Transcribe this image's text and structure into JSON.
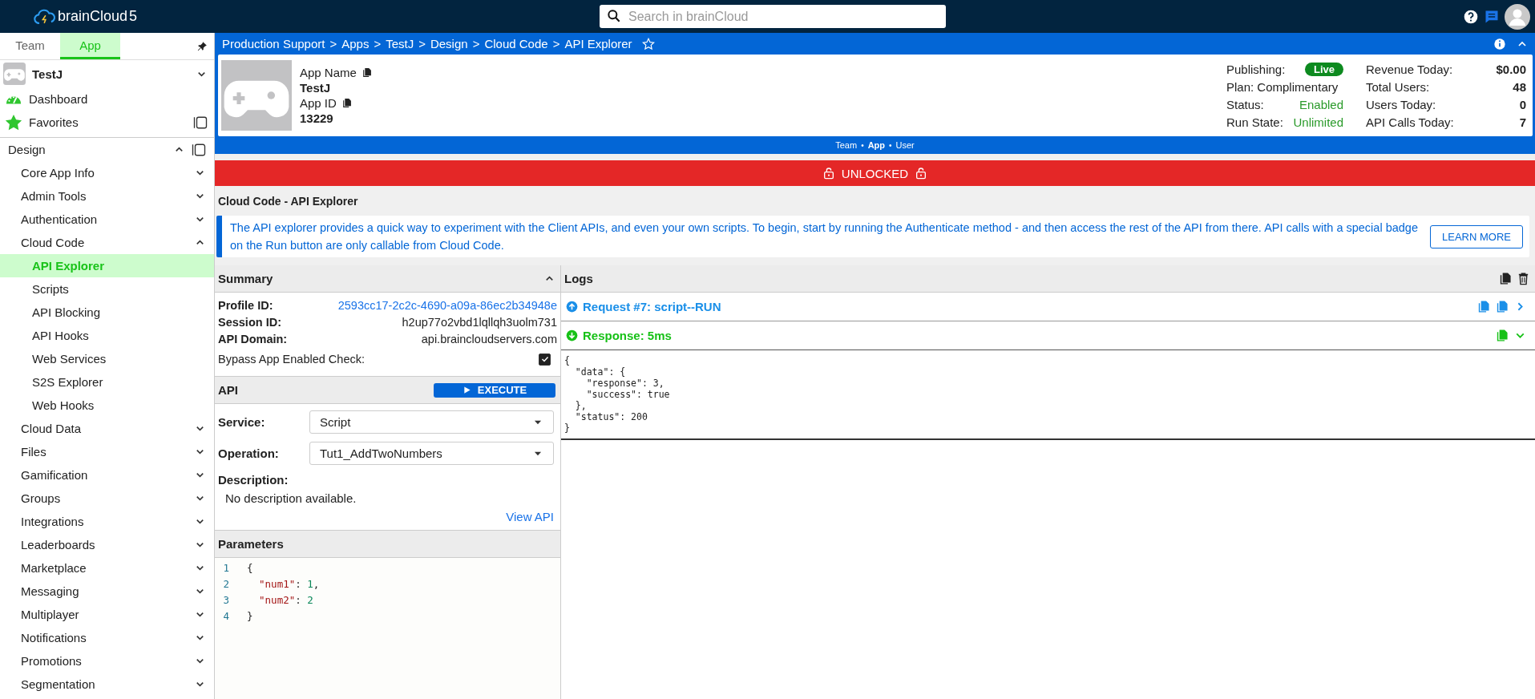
{
  "topbar": {
    "logo": "brainCloud",
    "logo_version": "5",
    "search": {
      "placeholder": "Search in brainCloud"
    }
  },
  "sidebar": {
    "tabs": [
      {
        "label": "Team",
        "selected": false
      },
      {
        "label": "App",
        "selected": true
      }
    ],
    "app": {
      "name": "TestJ"
    },
    "links": [
      {
        "label": "Dashboard",
        "kind": "dashboard"
      },
      {
        "label": "Favorites",
        "kind": "favorites"
      }
    ],
    "nav": [
      {
        "label": "Design",
        "expanded": true,
        "selected": false,
        "children": [
          {
            "label": "Core App Info",
            "expanded": false,
            "selected": false
          },
          {
            "label": "Admin Tools",
            "expanded": false,
            "selected": false
          },
          {
            "label": "Authentication",
            "expanded": false,
            "selected": false
          },
          {
            "label": "Cloud Code",
            "expanded": true,
            "selected": false,
            "children": [
              {
                "label": "API Explorer",
                "selected": true
              },
              {
                "label": "Scripts",
                "selected": false
              },
              {
                "label": "API Blocking",
                "selected": false
              },
              {
                "label": "API Hooks",
                "selected": false
              },
              {
                "label": "Web Services",
                "selected": false
              },
              {
                "label": "S2S Explorer",
                "selected": false
              },
              {
                "label": "Web Hooks",
                "selected": false
              }
            ]
          },
          {
            "label": "Cloud Data",
            "expanded": false,
            "selected": false
          },
          {
            "label": "Files",
            "expanded": false,
            "selected": false
          },
          {
            "label": "Gamification",
            "expanded": false,
            "selected": false
          },
          {
            "label": "Groups",
            "expanded": false,
            "selected": false
          },
          {
            "label": "Integrations",
            "expanded": false,
            "selected": false
          },
          {
            "label": "Leaderboards",
            "expanded": false,
            "selected": false
          },
          {
            "label": "Marketplace",
            "expanded": false,
            "selected": false
          },
          {
            "label": "Messaging",
            "expanded": false,
            "selected": false
          },
          {
            "label": "Multiplayer",
            "expanded": false,
            "selected": false
          },
          {
            "label": "Notifications",
            "expanded": false,
            "selected": false
          },
          {
            "label": "Promotions",
            "expanded": false,
            "selected": false
          },
          {
            "label": "Segmentation",
            "expanded": false,
            "selected": false
          }
        ]
      }
    ]
  },
  "breadcrumb_separator": ">",
  "context_separator": "•",
  "breadcrumb": [
    "Production Support",
    "Apps",
    "TestJ",
    "Design",
    "Cloud Code",
    "API Explorer"
  ],
  "app_info": {
    "name_label": "App Name",
    "name": "TestJ",
    "id_label": "App ID",
    "id": "13229",
    "publishing_label": "Publishing:",
    "publishing": "Live",
    "plan": "Plan: Complimentary",
    "status_label": "Status:",
    "status": "Enabled",
    "run_state_label": "Run State:",
    "run_state": "Unlimited",
    "stats": [
      {
        "label": "Revenue Today:",
        "value": "$0.00"
      },
      {
        "label": "Total Users:",
        "value": "48"
      },
      {
        "label": "Users Today:",
        "value": "0"
      },
      {
        "label": "API Calls Today:",
        "value": "7"
      }
    ]
  },
  "context": [
    {
      "label": "Team",
      "selected": false
    },
    {
      "label": "App",
      "selected": true
    },
    {
      "label": "User",
      "selected": false
    }
  ],
  "lock_banner": {
    "label": "UNLOCKED",
    "locked": false
  },
  "page_title": "Cloud Code - API Explorer",
  "info": {
    "text": "The API explorer provides a quick way to experiment with the Client APIs, and even your own scripts. To begin, start by running the Authenticate method - and then access the rest of the API from there. API calls with a special badge on the Run button are only callable from Cloud Code.",
    "button": "LEARN MORE"
  },
  "summary": {
    "title": "Summary",
    "expanded": true,
    "rows": [
      {
        "label": "Profile ID:",
        "value": "2593cc17-2c2c-4690-a09a-86ec2b34948e",
        "kind": "link"
      },
      {
        "label": "Session ID:",
        "value": "h2up77o2vbd1lqllqh3uolm731",
        "kind": "text"
      },
      {
        "label": "API Domain:",
        "value": "api.braincloudservers.com",
        "kind": "text"
      }
    ],
    "bypass": {
      "label": "Bypass App Enabled Check:",
      "checked": true
    }
  },
  "api": {
    "title": "API",
    "execute": "EXECUTE",
    "service_label": "Service:",
    "service": "Script",
    "operation_label": "Operation:",
    "operation": "Tut1_AddTwoNumbers",
    "description_label": "Description:",
    "description": "No description available.",
    "view_api": "View API"
  },
  "parameters": {
    "title": "Parameters",
    "lines": [
      {
        "number": "1",
        "text": "{"
      },
      {
        "number": "2",
        "text": "  \"num1\": 1,"
      },
      {
        "number": "3",
        "text": "  \"num2\": 2"
      },
      {
        "number": "4",
        "text": "}"
      }
    ]
  },
  "logs": {
    "title": "Logs",
    "entries": [
      {
        "kind": "request",
        "label": "Request #7: script--RUN",
        "expanded": false
      },
      {
        "kind": "response",
        "label": "Response: 5ms",
        "expanded": true,
        "body": "{\n  \"data\": {\n    \"response\": 3,\n    \"success\": true\n  },\n  \"status\": 200\n}"
      }
    ]
  }
}
